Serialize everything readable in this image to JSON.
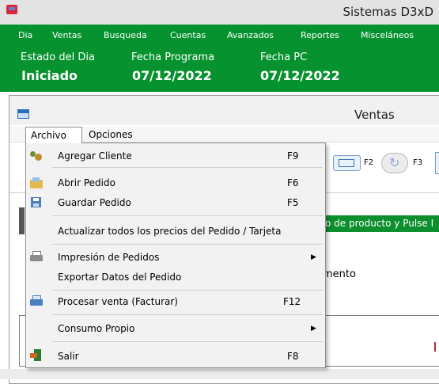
{
  "app": {
    "title": "Sistemas D3xD"
  },
  "main_menu": [
    "Dia",
    "Ventas",
    "Busqueda",
    "Cuentas",
    "Avanzados",
    "Reportes",
    "Misceláneos"
  ],
  "status": {
    "estado_label": "Estado del Dia",
    "estado_value": "Iniciado",
    "fecha_programa_label": "Fecha Programa",
    "fecha_programa_value": "07/12/2022",
    "fecha_pc_label": "Fecha PC",
    "fecha_pc_value": "07/12/2022"
  },
  "ventas": {
    "title": "Ventas",
    "menu": {
      "archivo": "Archivo",
      "opciones": "Opciones"
    },
    "toolbar": {
      "f2": "F2",
      "f3": "F3"
    },
    "banner_text": "o de producto y Pulse I",
    "partial_text": "mento"
  },
  "archivo_menu": [
    {
      "label": "Agregar Cliente",
      "shortcut": "F9",
      "icon": "users-icon"
    },
    {
      "label": "Abrir Pedido",
      "shortcut": "F6",
      "icon": "open-folder-icon"
    },
    {
      "label": "Guardar Pedido",
      "shortcut": "F5",
      "icon": "save-icon"
    },
    {
      "label": "Actualizar todos los precios del Pedido / Tarjeta",
      "shortcut": ""
    },
    {
      "label": "Impresión de Pedidos",
      "shortcut": "",
      "submenu": true,
      "icon": "printer-icon"
    },
    {
      "label": "Exportar Datos del Pedido",
      "shortcut": ""
    },
    {
      "label": "Procesar venta (Facturar)",
      "shortcut": "F12",
      "icon": "process-printer-icon"
    },
    {
      "label": "Consumo Propio",
      "shortcut": "",
      "submenu": true
    },
    {
      "label": "Salir",
      "shortcut": "F8",
      "icon": "exit-door-icon"
    }
  ]
}
